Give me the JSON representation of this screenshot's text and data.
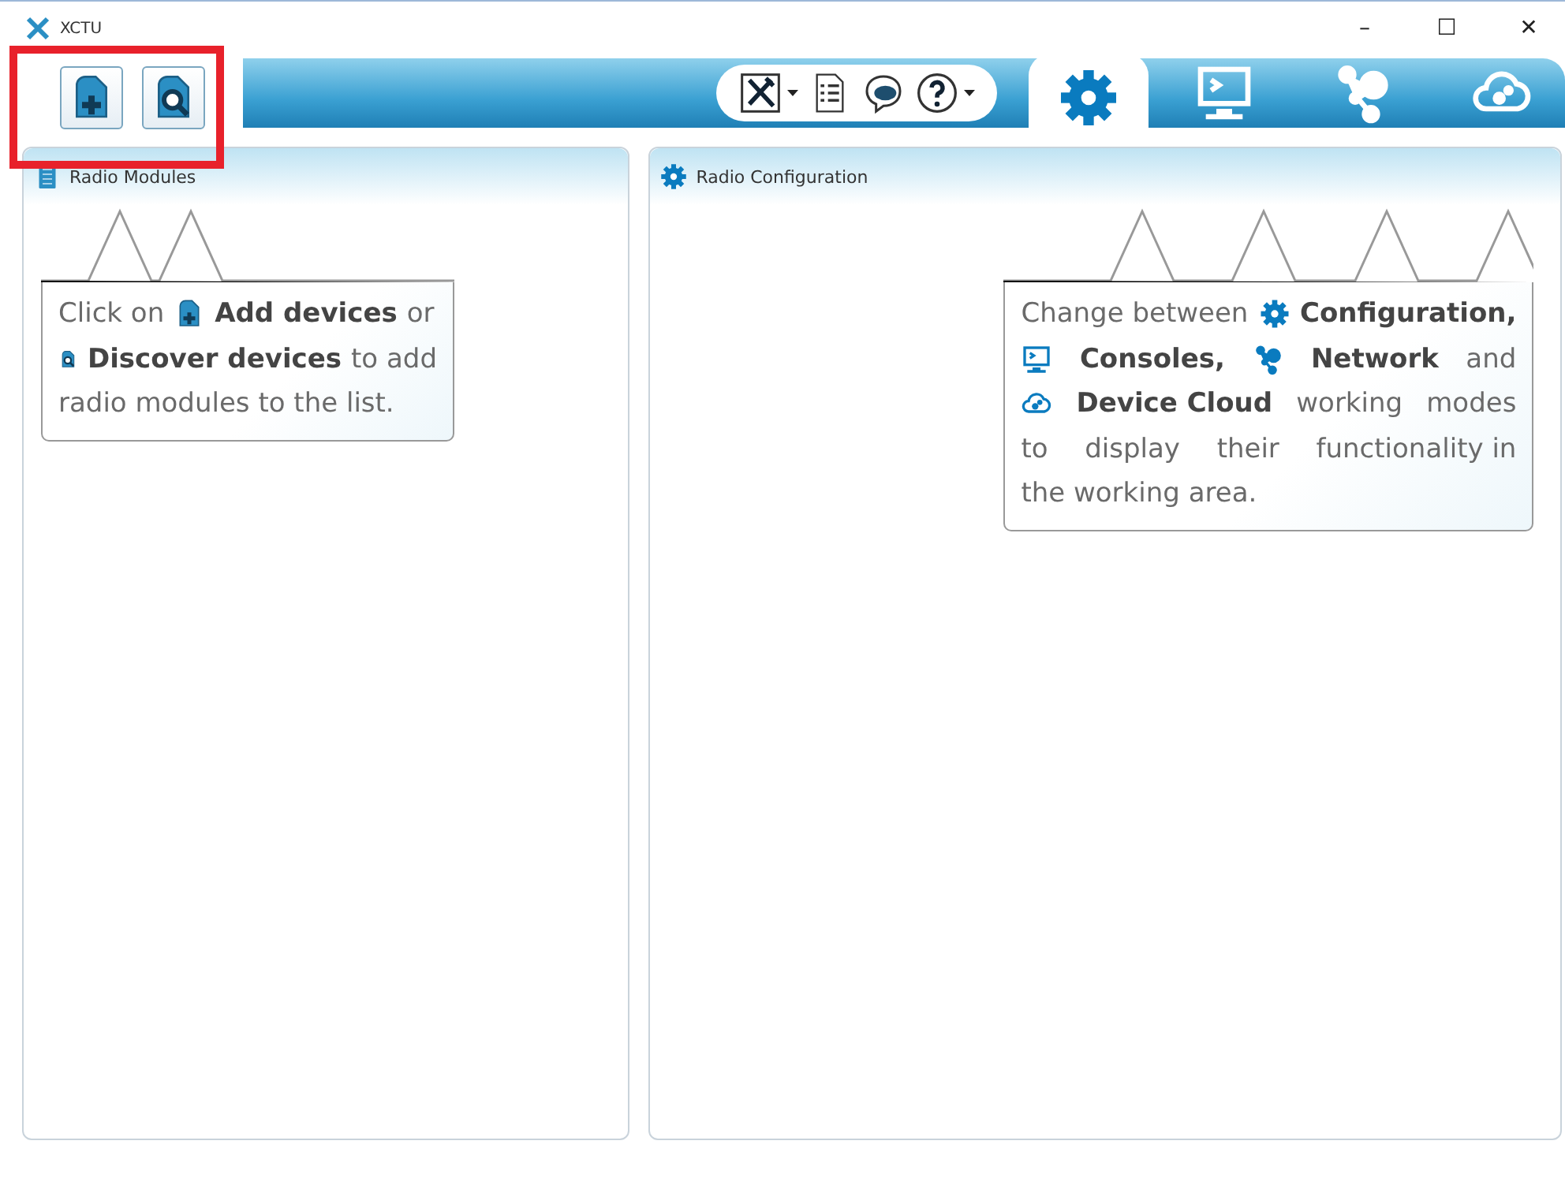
{
  "window": {
    "title": "XCTU",
    "controls": [
      "–",
      "☐",
      "✕"
    ]
  },
  "toolbar": {
    "highlighted": true,
    "tools": [
      {
        "dropdown": true
      },
      {
        "dropdown": false
      },
      {
        "dropdown": false
      },
      {
        "dropdown": true
      }
    ]
  },
  "modes": [
    {
      "selected": true
    },
    {
      "selected": false
    },
    {
      "selected": false
    },
    {
      "selected": false
    }
  ],
  "left_panel": {
    "title": "Radio Modules",
    "callout": {
      "lines": [
        [
          {
            "kind": "text",
            "text": "Click on"
          },
          {
            "kind": "add"
          },
          {
            "kind": "bold",
            "text": "Add devices"
          },
          {
            "kind": "text",
            "text": "or"
          }
        ],
        [
          {
            "kind": "discover"
          },
          {
            "kind": "bold",
            "text": "Discover devices"
          },
          {
            "kind": "text",
            "text": "to add"
          }
        ],
        [
          {
            "kind": "text",
            "text": "radio modules to the list."
          }
        ]
      ]
    }
  },
  "right_panel": {
    "title": "Radio Configuration",
    "callout": {
      "lines": [
        [
          {
            "kind": "text",
            "text": "Change between"
          },
          {
            "kind": "gear"
          },
          {
            "kind": "bold",
            "text": "Configuration,"
          }
        ],
        [
          {
            "kind": "console"
          },
          {
            "kind": "bold",
            "text": "Consoles,"
          },
          {
            "kind": "network"
          },
          {
            "kind": "bold",
            "text": "Network"
          },
          {
            "kind": "text",
            "text": "and"
          }
        ],
        [
          {
            "kind": "cloud"
          },
          {
            "kind": "bold",
            "text": "Device Cloud"
          },
          {
            "kind": "text",
            "text": "working"
          },
          {
            "kind": "text",
            "text": "modes"
          }
        ],
        [
          {
            "kind": "text",
            "text": "to"
          },
          {
            "kind": "text",
            "text": "display"
          },
          {
            "kind": "text",
            "text": "their"
          },
          {
            "kind": "text",
            "text": "functionality in"
          }
        ],
        [
          {
            "kind": "text",
            "text": "the working area."
          }
        ]
      ]
    }
  }
}
